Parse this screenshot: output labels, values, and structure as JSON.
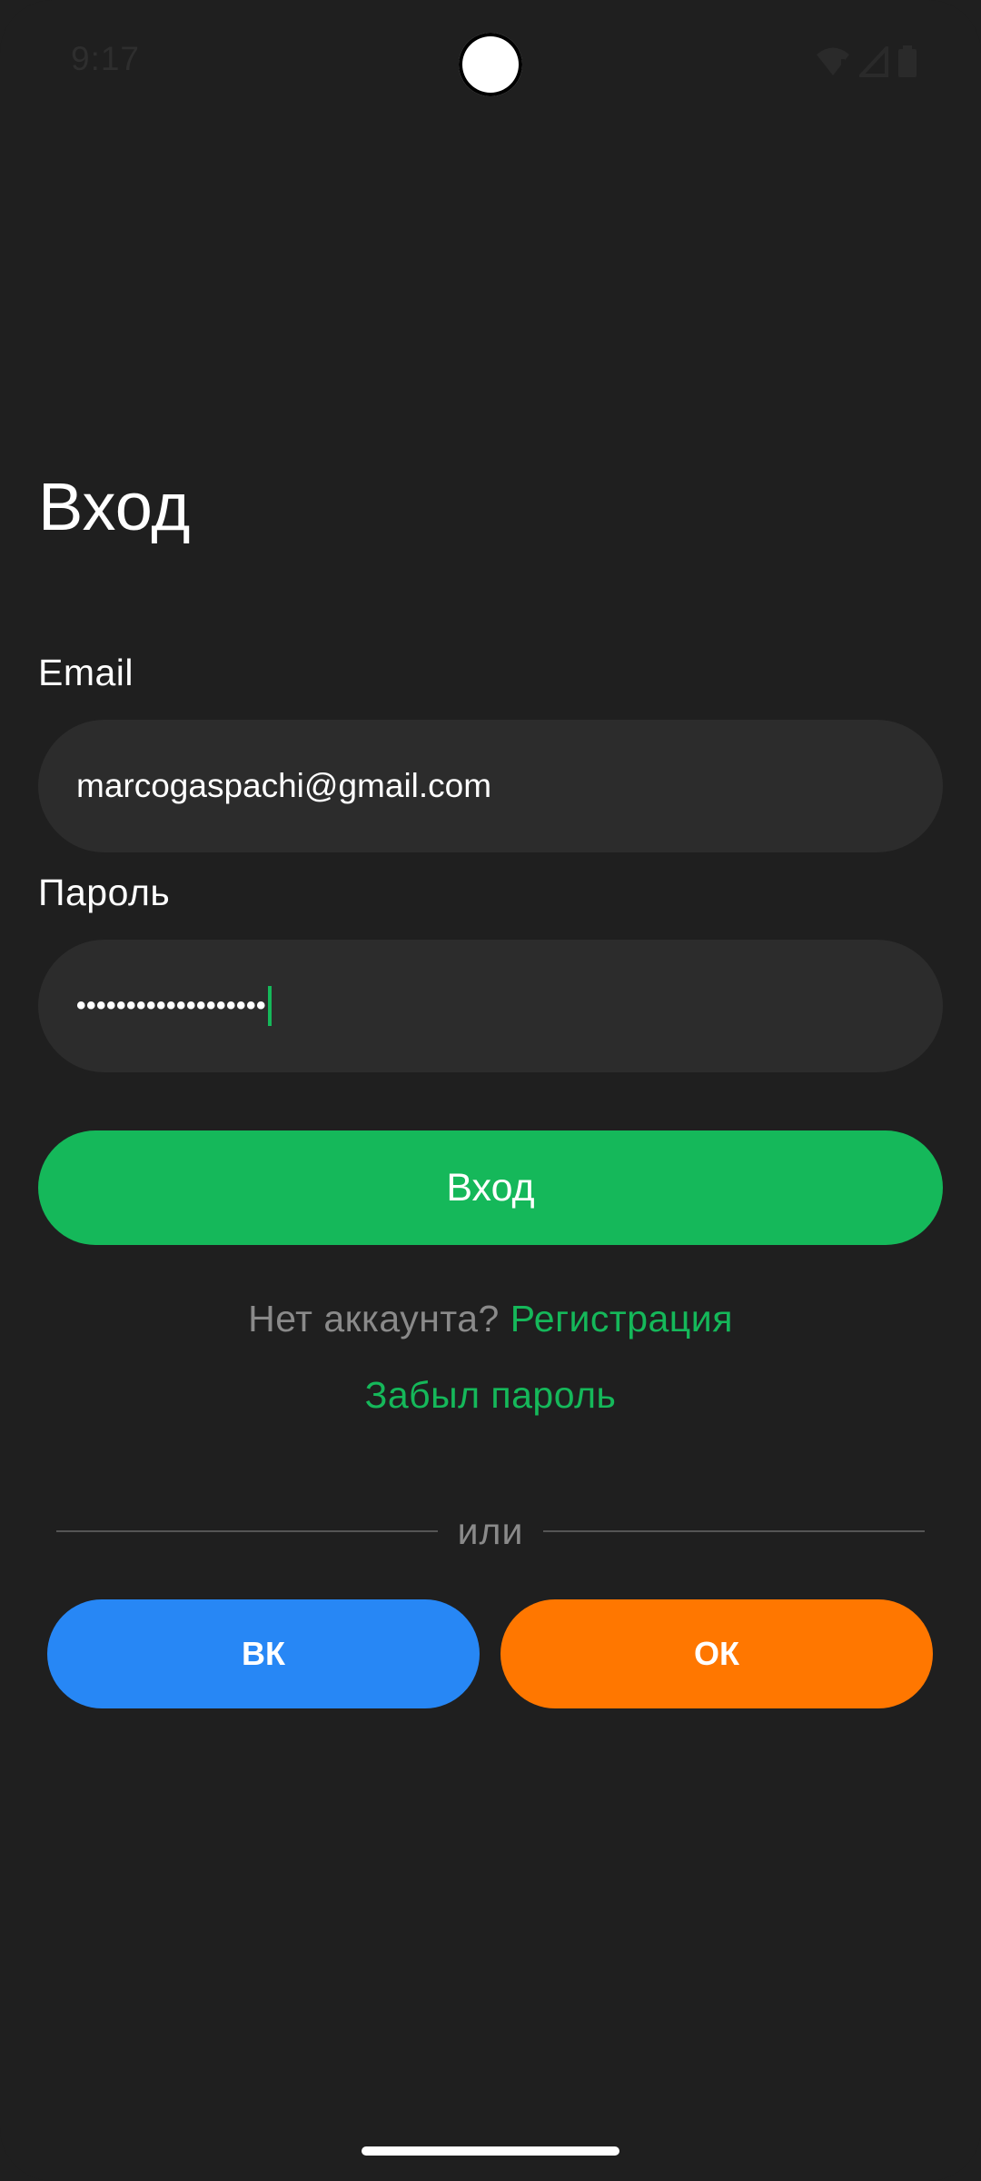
{
  "status_bar": {
    "time": "9:17"
  },
  "login": {
    "title": "Вход",
    "email_label": "Email",
    "email_value": "marcogaspachi@gmail.com",
    "password_label": "Пароль",
    "password_value": "•••••••••••••••••••",
    "submit_label": "Вход",
    "no_account_text": "Нет аккаунта?",
    "register_link": "Регистрация",
    "forgot_link": "Забыл пароль",
    "divider_text": "или"
  },
  "social": {
    "vk_label": "ВК",
    "ok_label": "ОК"
  },
  "colors": {
    "background": "#1f1f1f",
    "input_bg": "#2c2c2c",
    "accent_green": "#15b85a",
    "vk_blue": "#2787f5",
    "ok_orange": "#ff7700"
  }
}
